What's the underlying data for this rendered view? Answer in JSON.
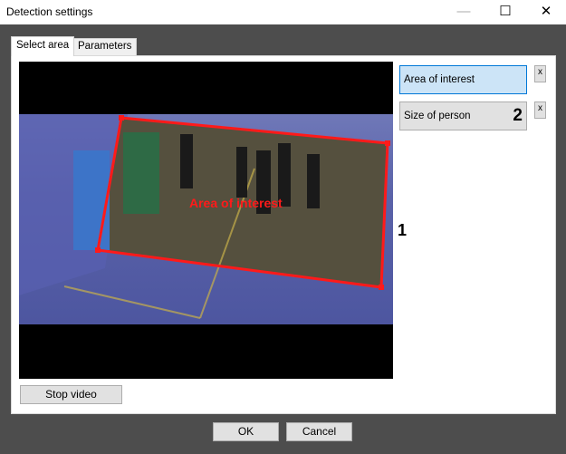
{
  "window": {
    "title": "Detection settings",
    "minimize": "—",
    "maximize": "☐",
    "close": "✕"
  },
  "tabs": [
    {
      "label": "Select area",
      "active": true
    },
    {
      "label": "Parameters",
      "active": false
    }
  ],
  "video": {
    "zone_label": "Area of interest",
    "annotation_1": "1",
    "zone_color": "#ff1a1a"
  },
  "side": {
    "items": [
      {
        "label": "Area of interest",
        "selected": true,
        "remove": "x"
      },
      {
        "label": "Size of person",
        "selected": false,
        "remove": "x",
        "annotation": "2"
      }
    ]
  },
  "buttons": {
    "stop_video": "Stop video",
    "ok": "OK",
    "cancel": "Cancel"
  }
}
